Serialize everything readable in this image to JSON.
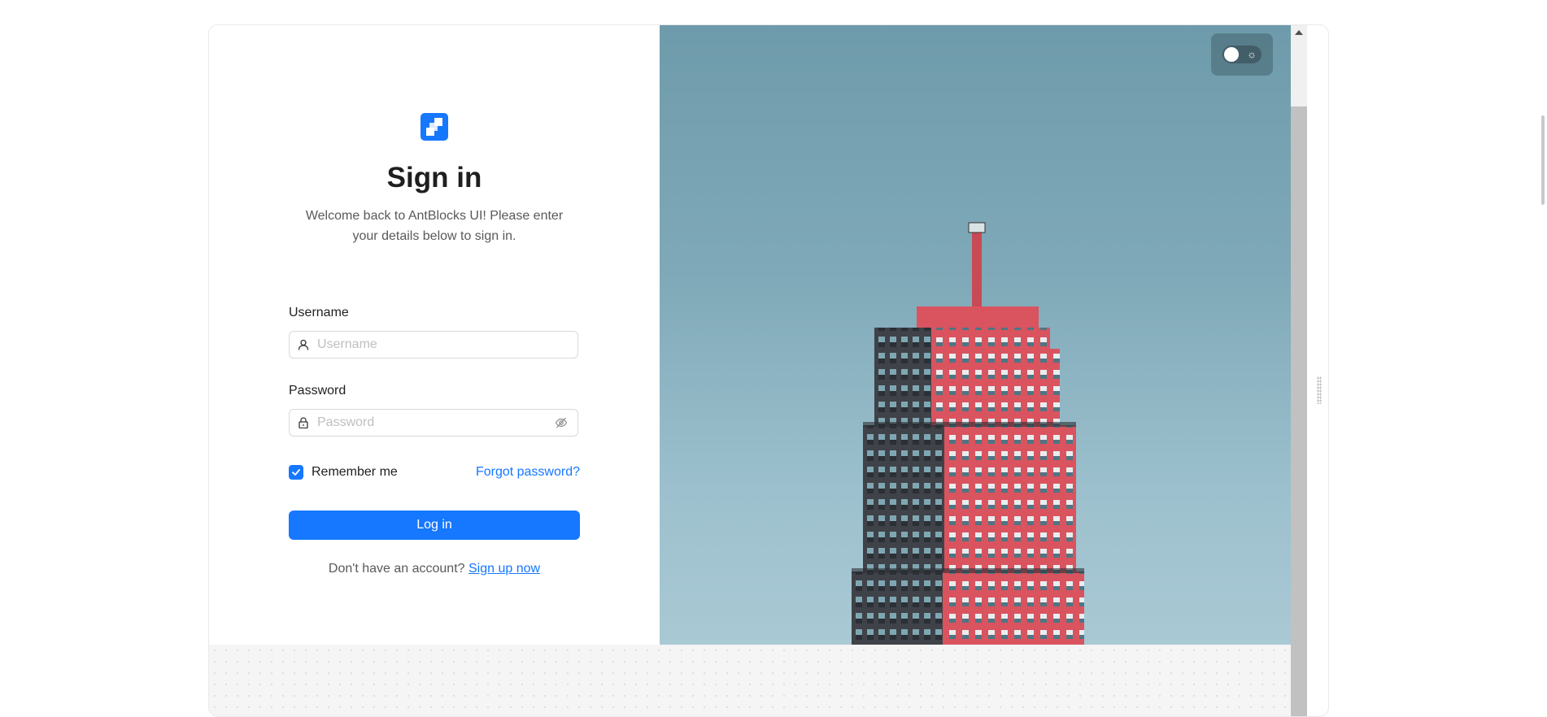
{
  "login": {
    "title": "Sign in",
    "subtitle": "Welcome back to AntBlocks UI! Please enter your details below to sign in.",
    "username_label": "Username",
    "username_placeholder": "Username",
    "password_label": "Password",
    "password_placeholder": "Password",
    "remember_label": "Remember me",
    "remember_checked": true,
    "forgot_link": "Forgot password?",
    "login_button": "Log in",
    "signup_prompt": "Don't have an account?",
    "signup_link": "Sign up now"
  },
  "icons": {
    "logo": "antblocks-logo-icon",
    "username_prefix": "user-icon",
    "password_prefix": "lock-icon",
    "password_suffix": "eye-invisible-icon",
    "checkbox": "check-icon",
    "theme_toggle": "sun-icon",
    "scroll_up": "chevron-up-icon"
  },
  "theme": {
    "accent": "#1677ff",
    "image_sky": "#7fa9b8",
    "building_red": "#d9545f",
    "building_dark": "#3f4248"
  }
}
